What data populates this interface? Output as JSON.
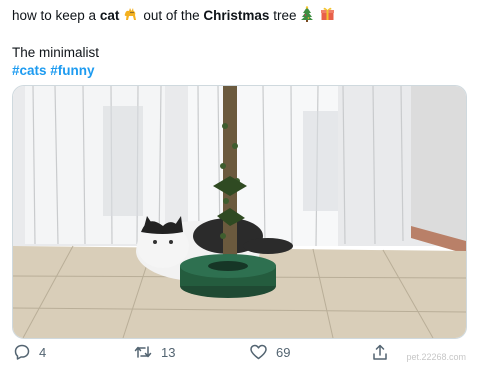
{
  "tweet": {
    "line1_part1": "how to keep a",
    "bold_cat": "cat",
    "line1_part2": "out of the",
    "bold_christmas": "Christmas",
    "line1_part3": "tree",
    "emojis": [
      "cat-emoji",
      "christmas-tree-emoji",
      "gift-emoji"
    ],
    "line2": "The minimalist",
    "hashtags": [
      "#cats",
      "#funny"
    ]
  },
  "media": {
    "image_icon": "cat-next-to-bare-christmas-tree-photo"
  },
  "actions": {
    "reply_count": "4",
    "retweet_count": "13",
    "like_count": "69"
  },
  "colors": {
    "link": "#1d9bf0",
    "text": "#0f1419",
    "secondary": "#536471"
  },
  "watermark": "pet.22268.com"
}
